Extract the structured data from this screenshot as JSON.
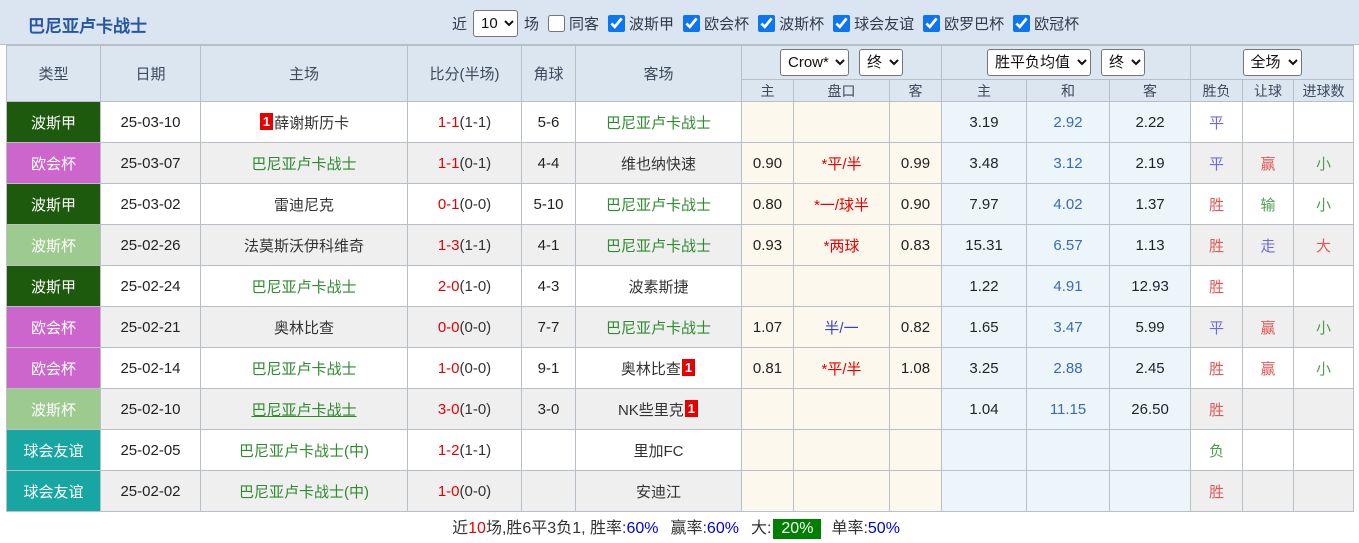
{
  "title": "巴尼亚卢卡战士",
  "filters": {
    "near_label": "近",
    "count_value": "10",
    "games_label": "场",
    "same_venue": {
      "label": "同客",
      "checked": false
    },
    "leagues": [
      {
        "label": "波斯甲",
        "checked": true
      },
      {
        "label": "欧会杯",
        "checked": true
      },
      {
        "label": "波斯杯",
        "checked": true
      },
      {
        "label": "球会友谊",
        "checked": true
      },
      {
        "label": "欧罗巴杯",
        "checked": true
      },
      {
        "label": "欧冠杯",
        "checked": true
      }
    ]
  },
  "table": {
    "headers": {
      "type": "类型",
      "date": "日期",
      "home": "主场",
      "score": "比分(半场)",
      "corner": "角球",
      "away": "客场",
      "bookmaker_select": "Crow*",
      "odds_time_select": "终",
      "avg_select": "胜平负均值",
      "avg_time_select": "终",
      "period_select": "全场",
      "sub_home": "主",
      "sub_handicap": "盘口",
      "sub_away": "客",
      "avg_home": "主",
      "avg_draw": "和",
      "avg_away": "客",
      "result": "胜负",
      "handicap_result": "让球",
      "goals_result": "进球数"
    },
    "rows": [
      {
        "league": "波斯甲",
        "lcls": "l1",
        "date": "25-03-10",
        "home": {
          "badge": "1",
          "name": "薛谢斯历卡",
          "cls": ""
        },
        "ft": "1-1",
        "ht": "(1-1)",
        "corner": "5-6",
        "away": {
          "name": "巴尼亚卢卡战士",
          "badge": "",
          "cls": "green"
        },
        "crow": {
          "h": "",
          "hc": "",
          "hcls": "",
          "a": ""
        },
        "avg": {
          "h": "3.19",
          "d": "2.92",
          "a": "2.22"
        },
        "res": {
          "t": "平",
          "cls": "b"
        },
        "hcp": {
          "t": "",
          "cls": ""
        },
        "goal": {
          "t": "",
          "cls": ""
        }
      },
      {
        "league": "欧会杯",
        "lcls": "l2",
        "date": "25-03-07",
        "home": {
          "badge": "",
          "name": "巴尼亚卢卡战士",
          "cls": "green"
        },
        "ft": "1-1",
        "ht": "(0-1)",
        "corner": "4-4",
        "away": {
          "name": "维也纳快速",
          "badge": "",
          "cls": ""
        },
        "crow": {
          "h": "0.90",
          "hc": "*平/半",
          "hcls": "red",
          "a": "0.99"
        },
        "avg": {
          "h": "3.48",
          "d": "3.12",
          "a": "2.19"
        },
        "res": {
          "t": "平",
          "cls": "b"
        },
        "hcp": {
          "t": "赢",
          "cls": "r"
        },
        "goal": {
          "t": "小",
          "cls": "g"
        }
      },
      {
        "league": "波斯甲",
        "lcls": "l1",
        "date": "25-03-02",
        "home": {
          "badge": "",
          "name": "雷迪尼克",
          "cls": ""
        },
        "ft": "0-1",
        "ht": "(0-0)",
        "corner": "5-10",
        "away": {
          "name": "巴尼亚卢卡战士",
          "badge": "",
          "cls": "green"
        },
        "crow": {
          "h": "0.80",
          "hc": "*一/球半",
          "hcls": "red",
          "a": "0.90"
        },
        "avg": {
          "h": "7.97",
          "d": "4.02",
          "a": "1.37"
        },
        "res": {
          "t": "胜",
          "cls": "r"
        },
        "hcp": {
          "t": "输",
          "cls": "g"
        },
        "goal": {
          "t": "小",
          "cls": "g"
        }
      },
      {
        "league": "波斯杯",
        "lcls": "l3",
        "date": "25-02-26",
        "home": {
          "badge": "",
          "name": "法莫斯沃伊科维奇",
          "cls": ""
        },
        "ft": "1-3",
        "ht": "(1-1)",
        "corner": "4-1",
        "away": {
          "name": "巴尼亚卢卡战士",
          "badge": "",
          "cls": "green"
        },
        "crow": {
          "h": "0.93",
          "hc": "*两球",
          "hcls": "red",
          "a": "0.83"
        },
        "avg": {
          "h": "15.31",
          "d": "6.57",
          "a": "1.13"
        },
        "res": {
          "t": "胜",
          "cls": "r"
        },
        "hcp": {
          "t": "走",
          "cls": "b"
        },
        "goal": {
          "t": "大",
          "cls": "r"
        }
      },
      {
        "league": "波斯甲",
        "lcls": "l1",
        "date": "25-02-24",
        "home": {
          "badge": "",
          "name": "巴尼亚卢卡战士",
          "cls": "green"
        },
        "ft": "2-0",
        "ht": "(1-0)",
        "corner": "4-3",
        "away": {
          "name": "波素斯捷",
          "badge": "",
          "cls": ""
        },
        "crow": {
          "h": "",
          "hc": "",
          "hcls": "",
          "a": ""
        },
        "avg": {
          "h": "1.22",
          "d": "4.91",
          "a": "12.93"
        },
        "res": {
          "t": "胜",
          "cls": "r"
        },
        "hcp": {
          "t": "",
          "cls": ""
        },
        "goal": {
          "t": "",
          "cls": ""
        }
      },
      {
        "league": "欧会杯",
        "lcls": "l2",
        "date": "25-02-21",
        "home": {
          "badge": "",
          "name": "奥林比查",
          "cls": ""
        },
        "ft": "0-0",
        "ht": "(0-0)",
        "corner": "7-7",
        "away": {
          "name": "巴尼亚卢卡战士",
          "badge": "",
          "cls": "green"
        },
        "crow": {
          "h": "1.07",
          "hc": "半/一",
          "hcls": "blue",
          "a": "0.82"
        },
        "avg": {
          "h": "1.65",
          "d": "3.47",
          "a": "5.99"
        },
        "res": {
          "t": "平",
          "cls": "b"
        },
        "hcp": {
          "t": "赢",
          "cls": "r"
        },
        "goal": {
          "t": "小",
          "cls": "g"
        }
      },
      {
        "league": "欧会杯",
        "lcls": "l2",
        "date": "25-02-14",
        "home": {
          "badge": "",
          "name": "巴尼亚卢卡战士",
          "cls": "green"
        },
        "ft": "1-0",
        "ht": "(0-0)",
        "corner": "9-1",
        "away": {
          "name": "奥林比查",
          "badge": "1",
          "cls": ""
        },
        "crow": {
          "h": "0.81",
          "hc": "*平/半",
          "hcls": "red",
          "a": "1.08"
        },
        "avg": {
          "h": "3.25",
          "d": "2.88",
          "a": "2.45"
        },
        "res": {
          "t": "胜",
          "cls": "r"
        },
        "hcp": {
          "t": "赢",
          "cls": "r"
        },
        "goal": {
          "t": "小",
          "cls": "g"
        }
      },
      {
        "league": "波斯杯",
        "lcls": "l3",
        "date": "25-02-10",
        "home": {
          "badge": "",
          "name": "巴尼亚卢卡战士",
          "cls": "green u"
        },
        "ft": "3-0",
        "ht": "(1-0)",
        "corner": "3-0",
        "away": {
          "name": "NK些里克",
          "badge": "1",
          "cls": ""
        },
        "crow": {
          "h": "",
          "hc": "",
          "hcls": "",
          "a": ""
        },
        "avg": {
          "h": "1.04",
          "d": "11.15",
          "a": "26.50"
        },
        "res": {
          "t": "胜",
          "cls": "r"
        },
        "hcp": {
          "t": "",
          "cls": ""
        },
        "goal": {
          "t": "",
          "cls": ""
        }
      },
      {
        "league": "球会友谊",
        "lcls": "l4",
        "date": "25-02-05",
        "home": {
          "badge": "",
          "name": "巴尼亚卢卡战士(中)",
          "cls": "green"
        },
        "ft": "1-2",
        "ht": "(1-1)",
        "corner": "",
        "away": {
          "name": "里加FC",
          "badge": "",
          "cls": ""
        },
        "crow": {
          "h": "",
          "hc": "",
          "hcls": "",
          "a": ""
        },
        "avg": {
          "h": "",
          "d": "",
          "a": ""
        },
        "res": {
          "t": "负",
          "cls": "g"
        },
        "hcp": {
          "t": "",
          "cls": ""
        },
        "goal": {
          "t": "",
          "cls": ""
        }
      },
      {
        "league": "球会友谊",
        "lcls": "l4",
        "date": "25-02-02",
        "home": {
          "badge": "",
          "name": "巴尼亚卢卡战士(中)",
          "cls": "green"
        },
        "ft": "1-0",
        "ht": "(0-0)",
        "corner": "",
        "away": {
          "name": "安迪江",
          "badge": "",
          "cls": ""
        },
        "crow": {
          "h": "",
          "hc": "",
          "hcls": "",
          "a": ""
        },
        "avg": {
          "h": "",
          "d": "",
          "a": ""
        },
        "res": {
          "t": "胜",
          "cls": "r"
        },
        "hcp": {
          "t": "",
          "cls": ""
        },
        "goal": {
          "t": "",
          "cls": ""
        }
      }
    ]
  },
  "summary": {
    "label_near": "近",
    "count": "10",
    "label_record": "场,胜6平3负1, 胜率:",
    "win_rate": "60%",
    "label_profit": "赢率:",
    "profit_rate": "60%",
    "label_big": "大:",
    "big_rate": "20%",
    "label_single": "单率:",
    "single_rate": "50%"
  },
  "colors": {
    "league_l1": "#1d5a0d",
    "league_l2": "#cc66cc",
    "league_l3": "#9cca8f",
    "league_l4": "#18a6a3",
    "focal_team_green": "#2e8b2e",
    "score_red": "#e60000",
    "result_red": "#e05858",
    "result_blue": "#6b6be0",
    "result_green": "#4f9e4f",
    "avg_mid_blue": "#3a6bb5",
    "crow_bg": "#fdf8ee",
    "avg_bg": "#ecf5fa",
    "header_bg": "#dce6f1",
    "summary_value_blue": "#0000e0",
    "summary_highlight_bg": "#008000",
    "title_blue": "#2456a4"
  }
}
